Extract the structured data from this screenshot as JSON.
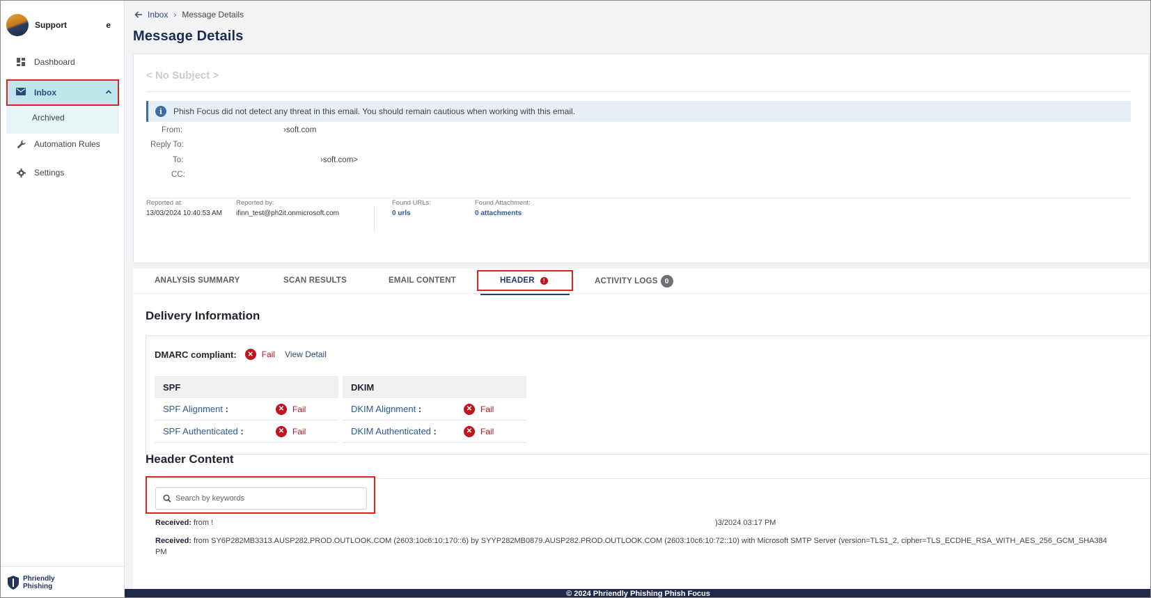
{
  "sidebar": {
    "user_name": "Support",
    "user_initial": "e",
    "items": [
      {
        "label": "Dashboard",
        "icon": "dashboard-icon"
      },
      {
        "label": "Inbox",
        "icon": "mail-icon"
      },
      {
        "label": "Automation Rules",
        "icon": "wrench-icon"
      },
      {
        "label": "Settings",
        "icon": "gear-icon"
      }
    ],
    "inbox_sub": "Archived",
    "brand": "Phriendly Phishing"
  },
  "breadcrumb": {
    "parent": "Inbox",
    "current": "Message Details"
  },
  "page_title": "Message Details",
  "message": {
    "subject": "< No Subject >",
    "alert": "Phish Focus did not detect any threat in this email. You should remain cautious when working with this email.",
    "labels": {
      "from": "From:",
      "reply_to": "Reply To:",
      "to": "To:",
      "cc": "CC:"
    },
    "from": "›soft.com",
    "to": "›soft.com>",
    "reported_at_label": "Reported at:",
    "reported_at": "13/03/2024 10:40:53 AM",
    "reported_by_label": "Reported by:",
    "reported_by": "ifinn_test@ph2it.onmicrosoft.com",
    "found_urls_label": "Found URLs:",
    "found_urls": "0 urls",
    "found_attach_label": "Found Attachment:",
    "found_attach": "0 attachments"
  },
  "tabs": [
    {
      "label": "ANALYSIS SUMMARY"
    },
    {
      "label": "SCAN RESULTS"
    },
    {
      "label": "EMAIL CONTENT"
    },
    {
      "label": "HEADER",
      "badge": "!"
    },
    {
      "label": "ACTIVITY LOGS",
      "badge": "0"
    }
  ],
  "delivery": {
    "title": "Delivery Information",
    "dmarc_label": "DMARC compliant:",
    "dmarc_status": "Fail",
    "view_detail": "View Detail",
    "spf": {
      "head": "SPF",
      "rows": [
        {
          "label": "SPF Alignment",
          "sep": ":",
          "status": "Fail"
        },
        {
          "label": "SPF Authenticated",
          "sep": ":",
          "status": "Fail"
        }
      ]
    },
    "dkim": {
      "head": "DKIM",
      "rows": [
        {
          "label": "DKIM Alignment",
          "sep": ":",
          "status": "Fail"
        },
        {
          "label": "DKIM Authenticated",
          "sep": ":",
          "status": "Fail"
        }
      ]
    }
  },
  "header_content": {
    "title": "Header Content",
    "search_placeholder": "Search by keywords",
    "received_label": "Received:",
    "line1_a": "from !",
    "line1_b": ")3/2024 03:17 PM",
    "line2": "from SY6P282MB3313.AUSP282.PROD.OUTLOOK.COM (2603:10c6:10:170::6) by SYYP282MB0879.AUSP282.PROD.OUTLOOK.COM (2603:10c6:10:72::10) with Microsoft SMTP Server (version=TLS1_2, cipher=TLS_ECDHE_RSA_WITH_AES_256_GCM_SHA384",
    "line2_cont": "PM"
  },
  "footer": "© 2024 Phriendly Phishing Phish Focus",
  "colors": {
    "accent": "#1f3a6e",
    "fail": "#c1121f",
    "highlight": "#e02020"
  }
}
